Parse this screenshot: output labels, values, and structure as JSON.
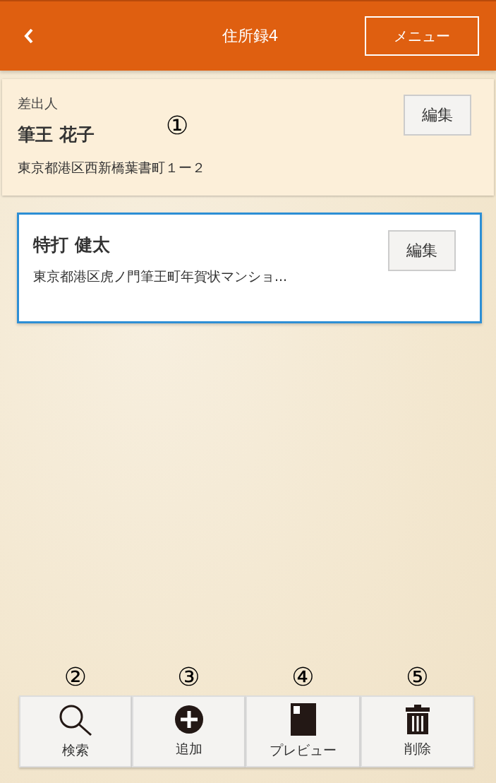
{
  "header": {
    "title": "住所録4",
    "menu_button": "メニュー"
  },
  "sender": {
    "label": "差出人",
    "name": "筆王 花子",
    "address": "東京都港区西新橋葉書町１ー２",
    "edit_button": "編集",
    "callout": "①"
  },
  "recipients": [
    {
      "name": "特打 健太",
      "address": "東京都港区虎ノ門筆王町年賀状マンショ...",
      "edit_button": "編集",
      "selected": true
    }
  ],
  "toolbar": [
    {
      "kind": "search",
      "label": "検索",
      "callout": "②"
    },
    {
      "kind": "add",
      "label": "追加",
      "callout": "③"
    },
    {
      "kind": "preview",
      "label": "プレビュー",
      "callout": "④"
    },
    {
      "kind": "delete",
      "label": "削除",
      "callout": "⑤"
    }
  ]
}
